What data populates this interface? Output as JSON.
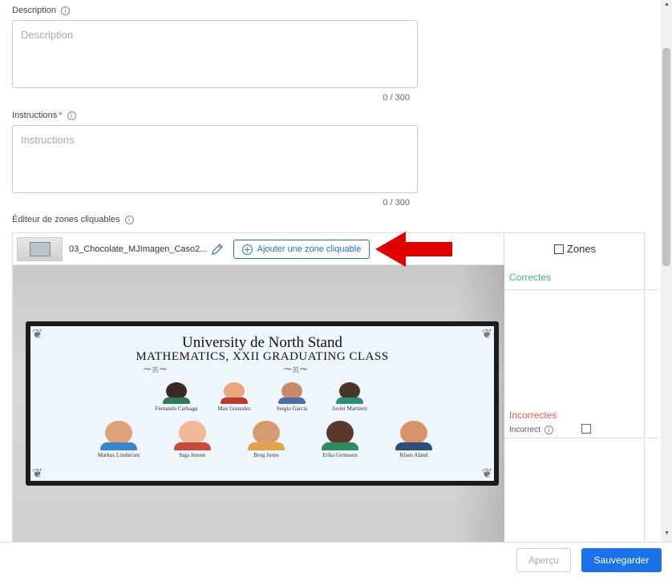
{
  "form": {
    "description": {
      "label": "Description",
      "placeholder": "Description",
      "counter": "0 / 300"
    },
    "instructions": {
      "label": "Instructions",
      "required_mark": "*",
      "placeholder": "Instructions",
      "counter": "0 / 300"
    },
    "editor_label": "Éditeur de zones cliquables"
  },
  "toolbar": {
    "filename": "03_Chocolate_MJImagen_Caso2...",
    "add_zone_label": "Ajouter une zone cliquable"
  },
  "board": {
    "title": "University de North Stand",
    "subtitle": "MATHEMATICS, XXII GRADUATING CLASS",
    "top_row": [
      {
        "name": "Fernando Carlsaga",
        "skin": "#3b2a22",
        "shirt": "#2f7a55"
      },
      {
        "name": "Max Gonzalez",
        "skin": "#e7a77d",
        "shirt": "#b93a2e"
      },
      {
        "name": "Sergio Garcia",
        "skin": "#c78b69",
        "shirt": "#4a6fa5"
      },
      {
        "name": "Javier Martinez",
        "skin": "#4a3428",
        "shirt": "#2b8d7a"
      }
    ],
    "bottom_row": [
      {
        "name": "Markus Lindstrom",
        "skin": "#e0a27a",
        "shirt": "#3a86c8"
      },
      {
        "name": "Inga Jensen",
        "skin": "#f0b896",
        "shirt": "#c74b3b"
      },
      {
        "name": "Borg Jones",
        "skin": "#d79b72",
        "shirt": "#e0a24a"
      },
      {
        "name": "Erika Gronsson",
        "skin": "#5a3a2c",
        "shirt": "#2f8a5e"
      },
      {
        "name": "Klaus Aland",
        "skin": "#d9936b",
        "shirt": "#2d4d7a"
      }
    ]
  },
  "zones": {
    "title": "Zones",
    "correct_label": "Correctes",
    "incorrect_label": "Incorrectes",
    "incorrect_item": "Incorrect"
  },
  "footer": {
    "preview_label": "Aperçu",
    "save_label": "Sauvegarder"
  },
  "colors": {
    "primary": "#1a73e8",
    "correct": "#3cb878",
    "incorrect": "#e8594b",
    "arrow": "#e00000"
  }
}
